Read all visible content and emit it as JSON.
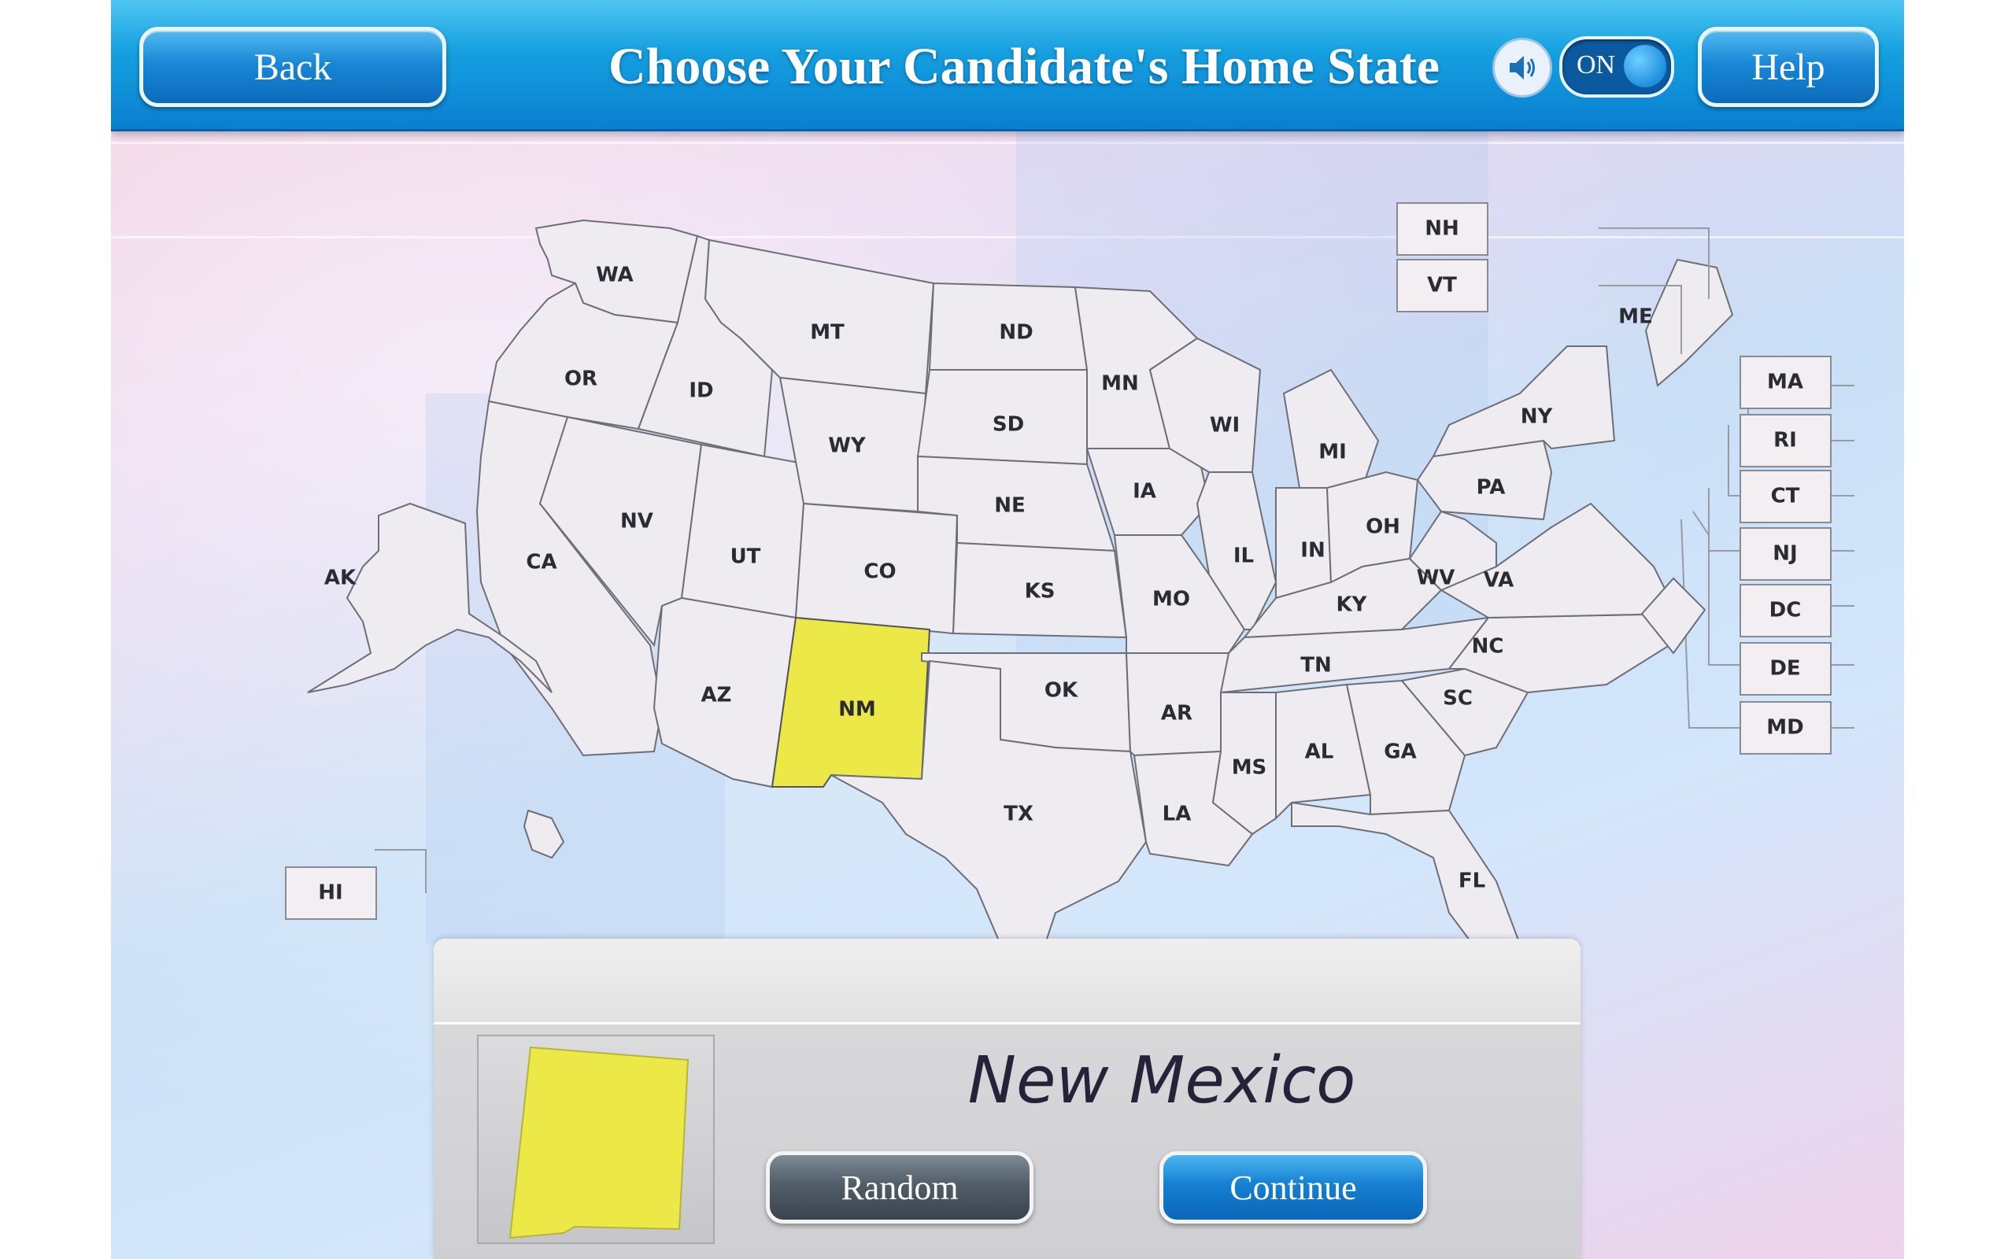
{
  "header": {
    "back_label": "Back",
    "title": "Choose Your Candidate's Home State",
    "sound_toggle_label": "ON",
    "help_label": "Help"
  },
  "map": {
    "selected_state": "NM",
    "state_labels": {
      "wa": "WA",
      "or": "OR",
      "ca": "CA",
      "id": "ID",
      "nv": "NV",
      "mt": "MT",
      "wy": "WY",
      "ut": "UT",
      "az": "AZ",
      "co": "CO",
      "nm": "NM",
      "nd": "ND",
      "sd": "SD",
      "ne": "NE",
      "ks": "KS",
      "ok": "OK",
      "tx": "TX",
      "mn": "MN",
      "ia": "IA",
      "mo": "MO",
      "ar": "AR",
      "la": "LA",
      "wi": "WI",
      "il": "IL",
      "mi": "MI",
      "in": "IN",
      "oh": "OH",
      "ky": "KY",
      "tn": "TN",
      "ms": "MS",
      "al": "AL",
      "ga": "GA",
      "fl": "FL",
      "sc": "SC",
      "nc": "NC",
      "va": "VA",
      "wv": "WV",
      "pa": "PA",
      "ny": "NY",
      "me": "ME",
      "ak": "AK",
      "hi": "HI",
      "nh": "NH",
      "vt": "VT",
      "ma": "MA",
      "ri": "RI",
      "ct": "CT",
      "nj": "NJ",
      "dc": "DC",
      "de": "DE",
      "md": "MD"
    }
  },
  "panel": {
    "state_name": "New Mexico",
    "random_label": "Random",
    "continue_label": "Continue"
  },
  "colors": {
    "selected_state": "#ebe848",
    "header_blue": "#0a7fd0",
    "random_button": "#515d68",
    "continue_button": "#1580d2"
  }
}
